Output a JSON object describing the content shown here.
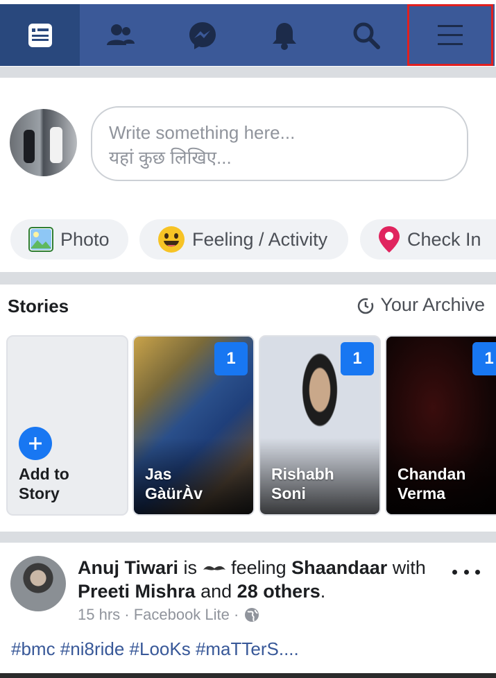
{
  "nav": {
    "items": [
      {
        "name": "news-feed",
        "icon": "news-feed-icon"
      },
      {
        "name": "friends",
        "icon": "friends-icon"
      },
      {
        "name": "messenger",
        "icon": "messenger-icon"
      },
      {
        "name": "notifications",
        "icon": "bell-icon"
      },
      {
        "name": "search",
        "icon": "search-icon"
      },
      {
        "name": "menu",
        "icon": "hamburger-menu-icon"
      }
    ],
    "colors": {
      "bar": "#3b5998",
      "active": "#29487d",
      "highlight": "#e02020"
    }
  },
  "composer": {
    "placeholder_line1": "Write something here...",
    "placeholder_line2": "यहां कुछ लिखिए...",
    "chips": [
      {
        "label": "Photo",
        "icon": "photo-icon"
      },
      {
        "label": "Feeling / Activity",
        "icon": "smiley-icon"
      },
      {
        "label": "Check In",
        "icon": "location-pin-icon"
      }
    ]
  },
  "stories": {
    "title": "Stories",
    "archive_label": "Your Archive",
    "add_line1": "Add to",
    "add_line2": "Story",
    "items": [
      {
        "name_line1": "Jas",
        "name_line2": "GàürÀv",
        "count": "1"
      },
      {
        "name_line1": "Rishabh",
        "name_line2": "Soni",
        "count": "1"
      },
      {
        "name_line1": "Chandan",
        "name_line2": "Verma",
        "count": "1"
      }
    ]
  },
  "post": {
    "author": "Anuj Tiwari",
    "is": "is",
    "feeling": "feeling",
    "feeling_word": "Shaandaar",
    "with": "with",
    "tagged": "Preeti Mishra",
    "and": "and",
    "others": "28 others",
    "time": "15 hrs · Facebook Lite ·",
    "text": "#bmc #ni8ride #LooKs #maTTerS...."
  }
}
